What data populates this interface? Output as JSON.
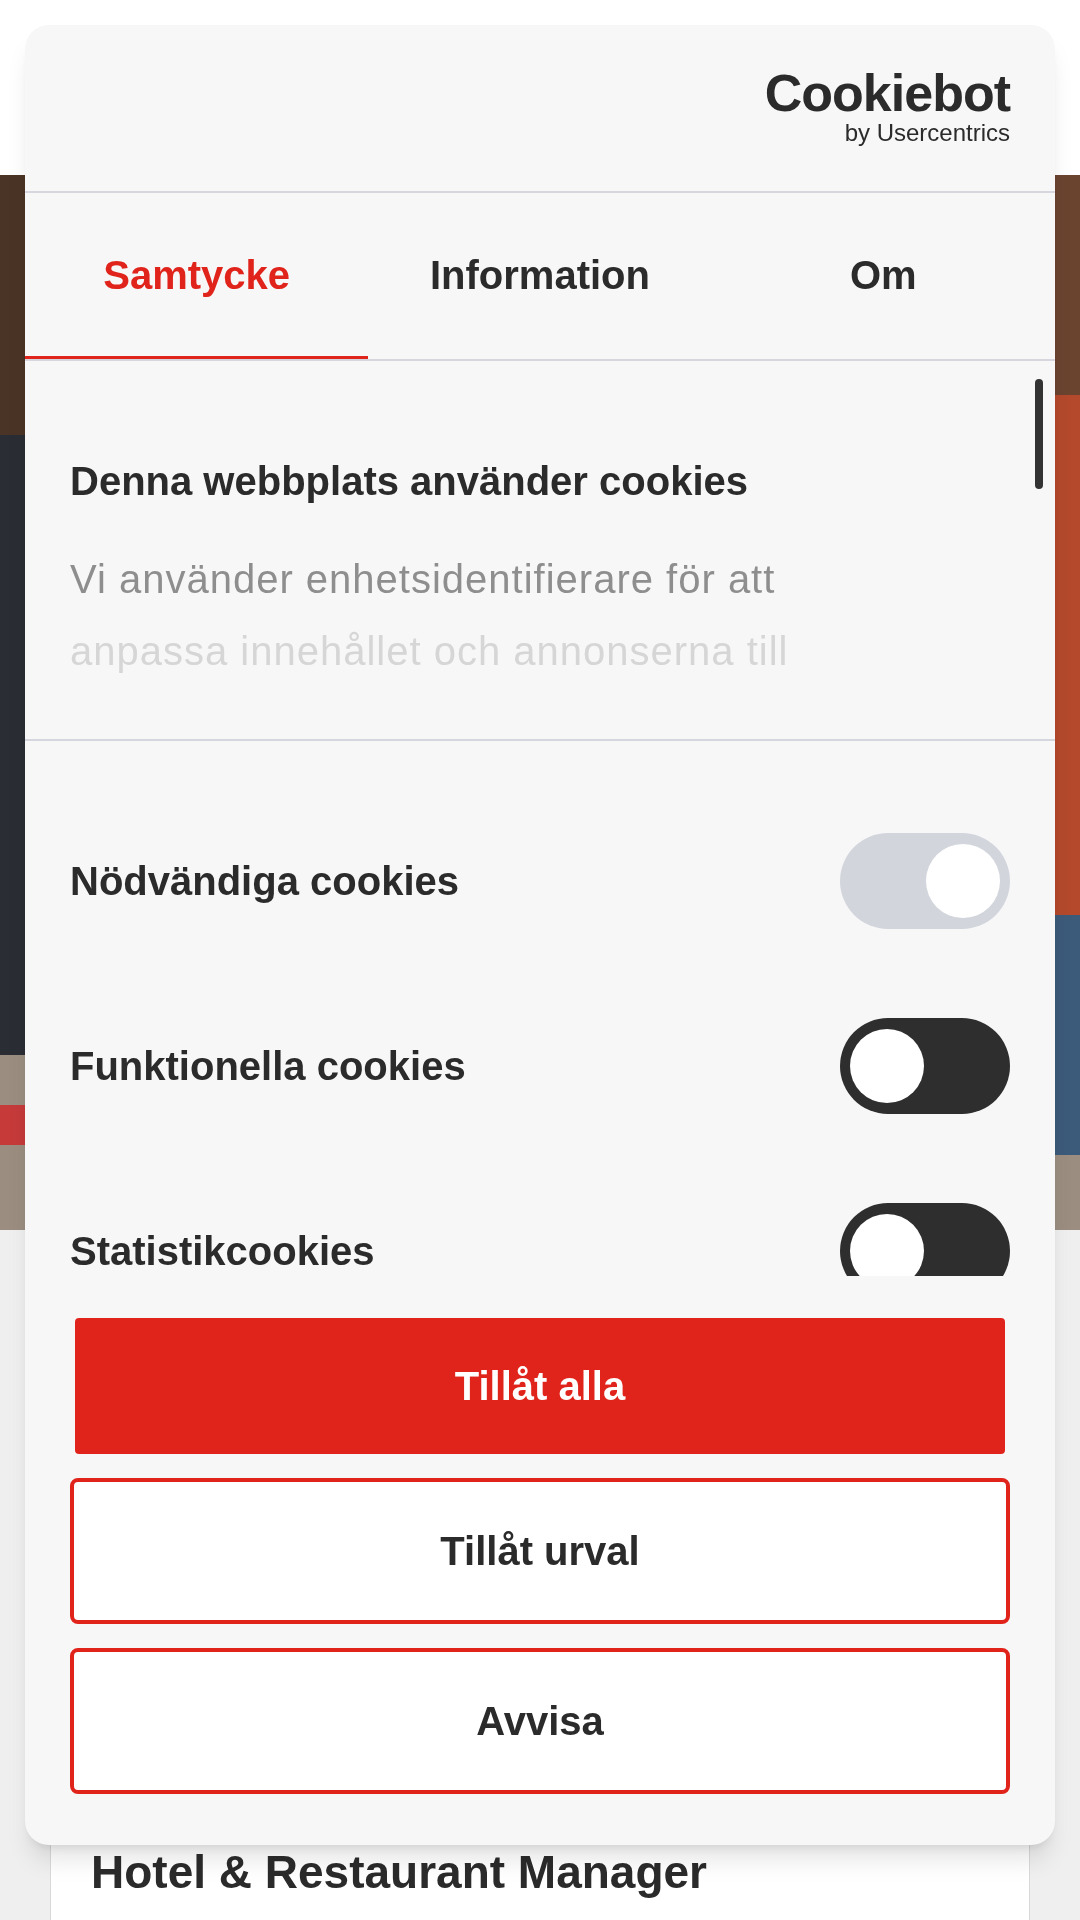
{
  "logo": {
    "wordmark": "Cookiebot",
    "byline": "by Usercentrics"
  },
  "tabs": [
    {
      "label": "Samtycke",
      "selected": true
    },
    {
      "label": "Information",
      "selected": false
    },
    {
      "label": "Om",
      "selected": false
    }
  ],
  "consent": {
    "heading": "Denna webbplats använder cookies",
    "body_lines": [
      "Vi använder enhetsidentifierare för att",
      "anpassa innehållet och annonserna till"
    ]
  },
  "toggles": [
    {
      "label": "Nödvändiga cookies",
      "on": true,
      "disabled": true
    },
    {
      "label": "Funktionella cookies",
      "on": false,
      "disabled": false
    },
    {
      "label": "Statistikcookies",
      "on": false,
      "disabled": false
    }
  ],
  "buttons": [
    {
      "label": "Tillåt alla",
      "kind": "primary"
    },
    {
      "label": "Tillåt urval",
      "kind": "outline"
    },
    {
      "label": "Avvisa",
      "kind": "outline"
    }
  ],
  "background_page": {
    "heading": "Hotel & Restaurant Manager"
  }
}
